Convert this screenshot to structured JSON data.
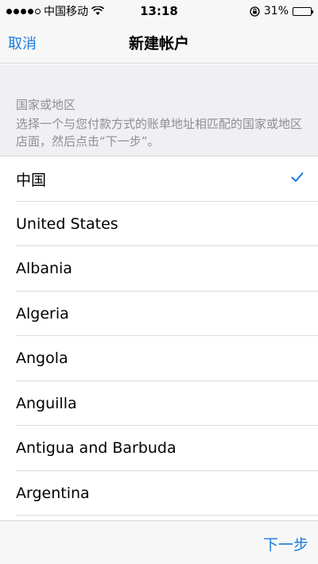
{
  "status_bar": {
    "carrier": "中国移动",
    "time": "13:18",
    "battery": "31%",
    "battery_level": 0.31,
    "icons": [
      "signal-dots-icon",
      "wifi-icon",
      "rotation-lock-icon",
      "battery-icon"
    ]
  },
  "nav": {
    "cancel_label": "取消",
    "title": "新建帐户"
  },
  "info": {
    "header": "国家或地区",
    "description": "选择一个与您付款方式的账单地址相匹配的国家或地区店面，然后点击“下一步”。"
  },
  "countries": [
    {
      "label": "中国",
      "selected": true
    },
    {
      "label": "United States",
      "selected": false
    },
    {
      "label": "Albania",
      "selected": false
    },
    {
      "label": "Algeria",
      "selected": false
    },
    {
      "label": "Angola",
      "selected": false
    },
    {
      "label": "Anguilla",
      "selected": false
    },
    {
      "label": "Antigua and Barbuda",
      "selected": false
    },
    {
      "label": "Argentina",
      "selected": false
    }
  ],
  "toolbar": {
    "next_label": "下一步"
  },
  "colors": {
    "accent": "#1a7be0",
    "bar_bg": "#f7f7f7",
    "section_bg": "#efeff4"
  }
}
